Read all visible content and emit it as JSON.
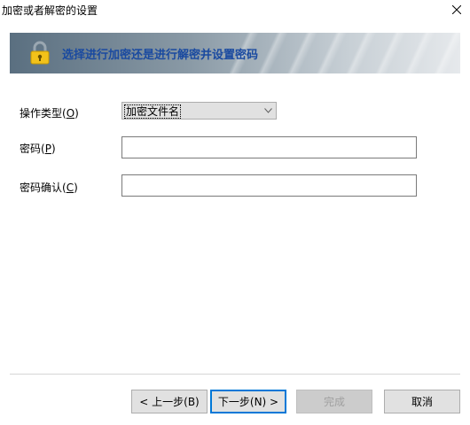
{
  "window": {
    "title": "加密或者解密的设置",
    "close_symbol": "close-icon"
  },
  "banner": {
    "icon": "lock-icon",
    "text": "选择进行加密还是进行解密并设置密码",
    "text_color": "#1a4aa0"
  },
  "form": {
    "operation": {
      "label_prefix": "操作类型(",
      "label_key": "O",
      "label_suffix": ")",
      "selected": "加密文件名"
    },
    "password": {
      "label_prefix": "密码(",
      "label_key": "P",
      "label_suffix": ")",
      "value": ""
    },
    "confirm": {
      "label_prefix": "密码确认(",
      "label_key": "C",
      "label_suffix": ")",
      "value": ""
    }
  },
  "buttons": {
    "back": "< 上一步(B)",
    "next": "下一步(N) >",
    "finish": "完成",
    "cancel": "取消"
  },
  "colors": {
    "accent": "#0078d7"
  }
}
